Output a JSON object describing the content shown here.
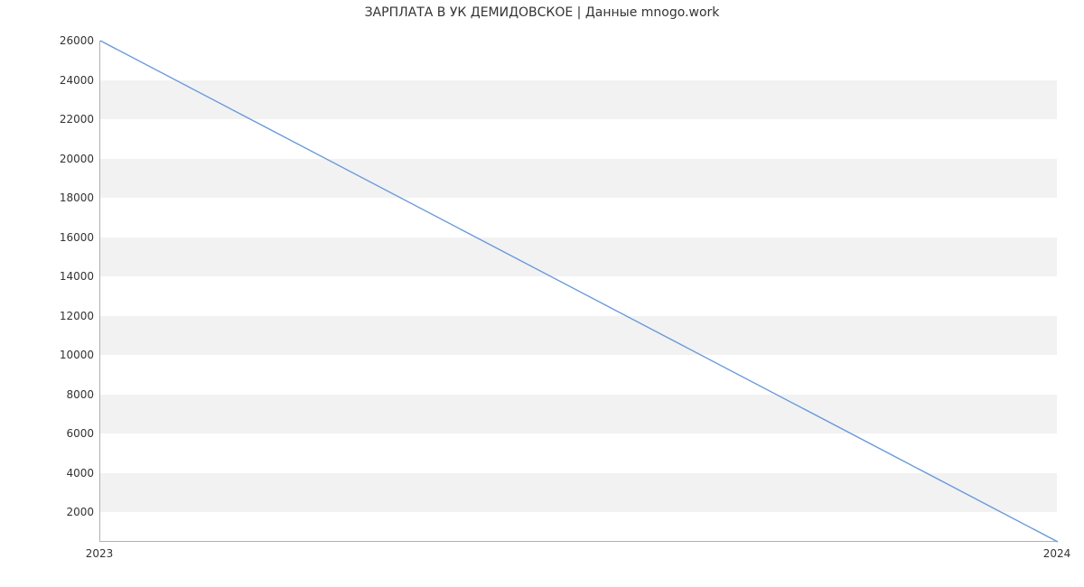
{
  "chart_data": {
    "type": "line",
    "title": "ЗАРПЛАТА В УК ДЕМИДОВСКОЕ | Данные mnogo.work",
    "xlabel": "",
    "ylabel": "",
    "x": [
      2023,
      2024
    ],
    "values": [
      26000,
      500
    ],
    "xlim": [
      2023,
      2024
    ],
    "ylim": [
      500,
      26000
    ],
    "x_ticks": [
      2023,
      2024
    ],
    "y_ticks": [
      2000,
      4000,
      6000,
      8000,
      10000,
      12000,
      14000,
      16000,
      18000,
      20000,
      22000,
      24000,
      26000
    ],
    "line_color": "#6699dd",
    "band_color": "#f2f2f2"
  }
}
